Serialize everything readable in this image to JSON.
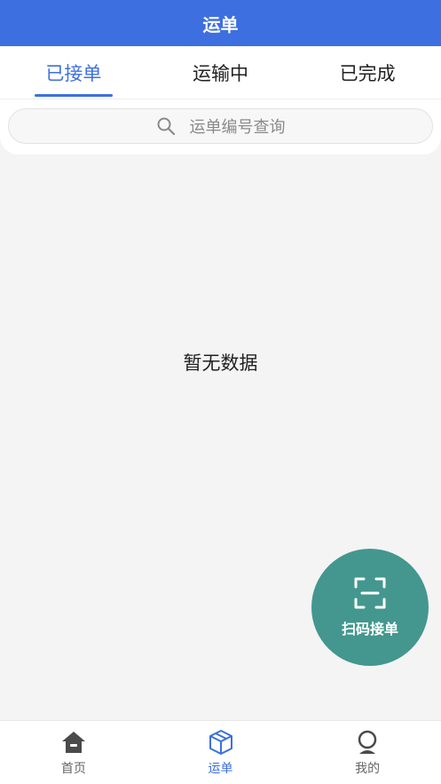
{
  "header": {
    "title": "运单"
  },
  "tabs": [
    {
      "label": "已接单",
      "active": true
    },
    {
      "label": "运输中",
      "active": false
    },
    {
      "label": "已完成",
      "active": false
    }
  ],
  "search": {
    "placeholder": "运单编号查询",
    "icon": "search-icon"
  },
  "empty": {
    "text": "暂无数据"
  },
  "fab": {
    "label": "扫码接单",
    "icon": "scan-icon"
  },
  "tabbar": [
    {
      "label": "首页",
      "icon": "home-icon",
      "active": false
    },
    {
      "label": "运单",
      "icon": "package-icon",
      "active": true
    },
    {
      "label": "我的",
      "icon": "profile-icon",
      "active": false
    }
  ],
  "colors": {
    "primary": "#3d6fe0",
    "fab": "#43978e",
    "background": "#f4f4f4",
    "inactive_icon": "#4a4a4a"
  }
}
